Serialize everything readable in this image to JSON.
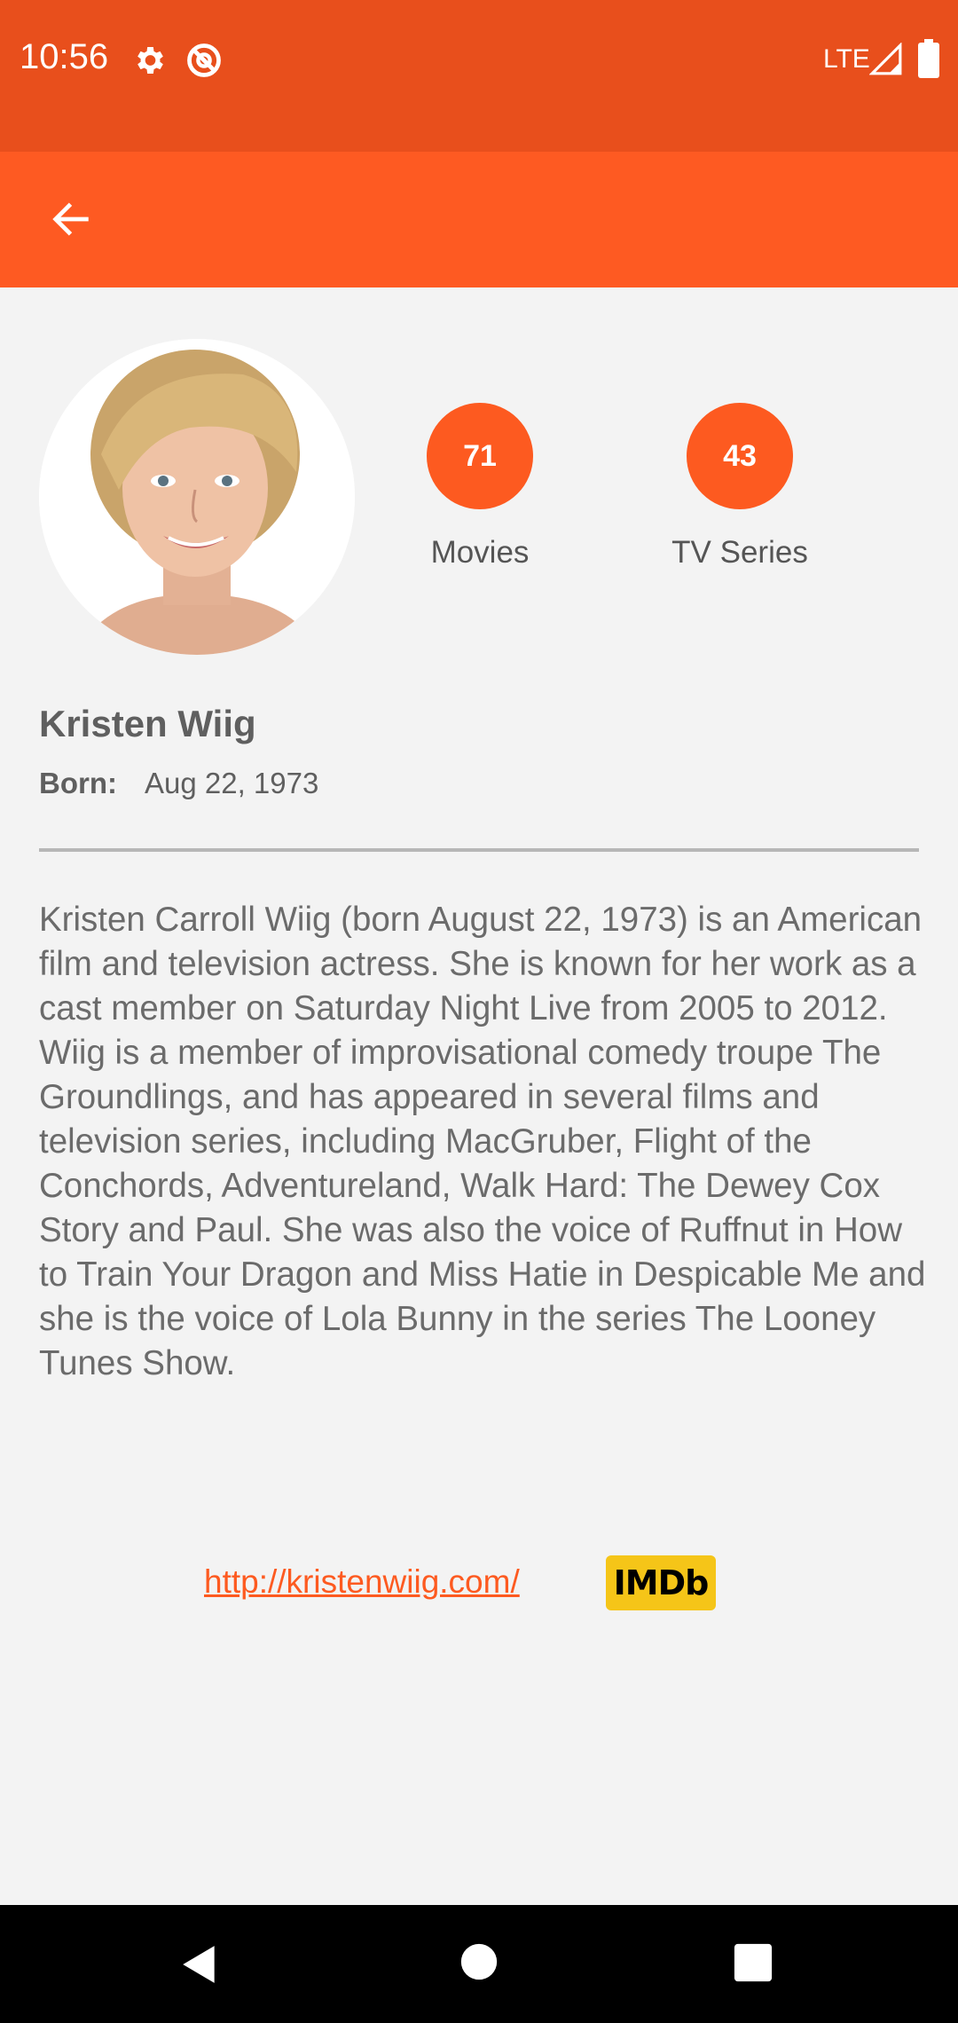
{
  "status_bar": {
    "time": "10:56",
    "network": "LTE",
    "icons": [
      "gear-icon",
      "sync-off-icon",
      "signal-icon",
      "battery-icon"
    ]
  },
  "app_bar": {
    "back_icon": "arrow-left-icon",
    "color": "#fe5a22"
  },
  "profile": {
    "name": "Kristen Wiig",
    "born_label": "Born:",
    "born_value": "Aug 22, 1973",
    "movies_count": "71",
    "movies_label": "Movies",
    "tv_count": "43",
    "tv_label": "TV Series",
    "bio": "Kristen Carroll Wiig (born August 22, 1973) is an American film and television actress. She is known for her work as a cast member on Saturday Night Live from 2005 to 2012. Wiig is a member of improvisational comedy troupe The Groundlings, and has appeared in several films and television series, including MacGruber, Flight of the Conchords, Adventureland, Walk Hard: The Dewey Cox Story and Paul. She was also the voice of Ruffnut in How to Train Your Dragon and Miss Hatie in Despicable Me and she is the voice of Lola Bunny in the series The Looney Tunes Show.",
    "website": "http://kristenwiig.com/",
    "imdb_label": "IMDb"
  },
  "nav_bar": {
    "buttons": [
      "back-triangle-icon",
      "home-circle-icon",
      "recents-square-icon"
    ]
  },
  "colors": {
    "status_bar": "#e84f1c",
    "accent": "#fd5a20",
    "imdb": "#f5c518",
    "background": "#f3f3f3"
  }
}
